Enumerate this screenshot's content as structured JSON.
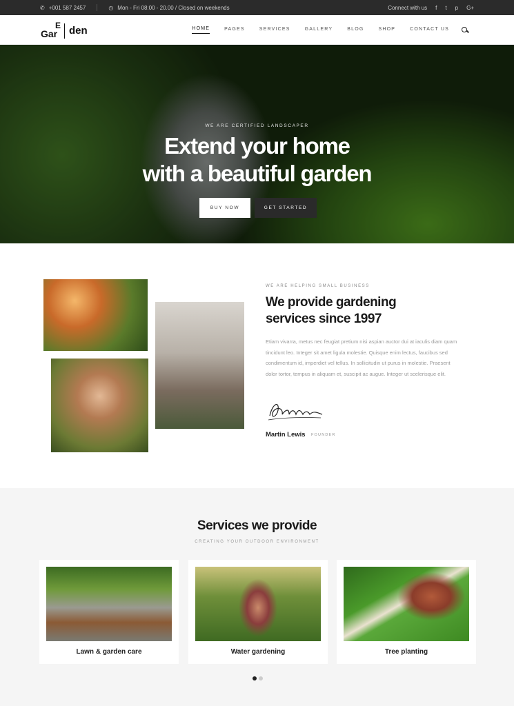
{
  "topbar": {
    "phone": "+001 587 2457",
    "hours": "Mon - Fri 08:00 - 20.00 / Closed on weekends",
    "connect_label": "Connect with us",
    "social": [
      {
        "icon": "facebook-icon",
        "glyph": "f"
      },
      {
        "icon": "twitter-icon",
        "glyph": "t"
      },
      {
        "icon": "pinterest-icon",
        "glyph": "p"
      },
      {
        "icon": "google-plus-icon",
        "glyph": "G+"
      }
    ]
  },
  "logo": {
    "part1": "Gar",
    "part2": "E",
    "part3": "den"
  },
  "nav": {
    "items": [
      "HOME",
      "PAGES",
      "SERVICES",
      "GALLERY",
      "BLOG",
      "SHOP",
      "CONTACT US"
    ],
    "active": "HOME"
  },
  "hero": {
    "kicker": "WE ARE CERTIFIED LANDSCAPER",
    "title_line1": "Extend your home",
    "title_line2": "with a beautiful garden",
    "btn_primary": "BUY NOW",
    "btn_secondary": "GET STARTED"
  },
  "about": {
    "kicker": "WE ARE HELPING SMALL BUSINESS",
    "title_line1": "We provide gardening",
    "title_line2": "services since 1997",
    "body": "Etiam vivarra, metus nec feugiat pretium nisi aspian auctor dui at iaculis diam quam tincidunt leo. Integer sit amet ligula molestie. Quisque enim lectus, faucibus sed condimentum id, imperdiet vel tellus. In sollicitudin ut purus in molestie. Praesent dolor tortor, tempus in aliquam et, suscipit ac augue. Integer ut scelerisque elit.",
    "name": "Martin Lewis",
    "role": "FOUNDER"
  },
  "services": {
    "title": "Services we provide",
    "subtitle": "CREATING YOUR OUTDOOR ENVIRONMENT",
    "cards": [
      {
        "label": "Lawn & garden care"
      },
      {
        "label": "Water gardening"
      },
      {
        "label": "Tree planting"
      }
    ]
  }
}
